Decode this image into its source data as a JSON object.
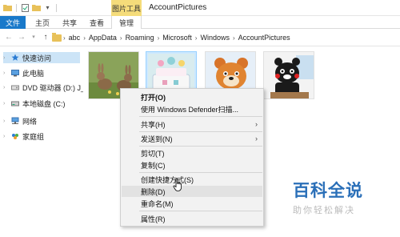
{
  "titlebar": {
    "context_tab_header": "图片工具",
    "window_title": "AccountPictures"
  },
  "ribbon": {
    "tabs": [
      {
        "label": "文件"
      },
      {
        "label": "主页"
      },
      {
        "label": "共享"
      },
      {
        "label": "查看"
      },
      {
        "label": "管理"
      }
    ]
  },
  "address": {
    "crumbs": [
      "abc",
      "AppData",
      "Roaming",
      "Microsoft",
      "Windows",
      "AccountPictures"
    ]
  },
  "navpane": {
    "items": [
      {
        "label": "快速访问",
        "icon": "star-icon"
      },
      {
        "label": "此电脑",
        "icon": "computer-icon"
      },
      {
        "label": "DVD 驱动器 (D:) J_C",
        "icon": "dvd-icon"
      },
      {
        "label": "本地磁盘 (C:)",
        "icon": "drive-icon"
      },
      {
        "label": "网络",
        "icon": "network-icon"
      },
      {
        "label": "家庭组",
        "icon": "homegroup-icon"
      }
    ]
  },
  "files": [
    {
      "name": "rabbits",
      "icon": "image-thumbnail"
    },
    {
      "name": "cake",
      "icon": "image-thumbnail"
    },
    {
      "name": "bear",
      "icon": "image-thumbnail"
    },
    {
      "name": "kumamon",
      "icon": "image-thumbnail"
    }
  ],
  "context_menu": {
    "items": [
      {
        "label": "打开(O)"
      },
      {
        "label": "使用 Windows Defender扫描..."
      },
      {
        "label": "共享(H)"
      },
      {
        "label": "发送到(N)"
      },
      {
        "label": "剪切(T)"
      },
      {
        "label": "复制(C)"
      },
      {
        "label": "创建快捷方式(S)"
      },
      {
        "label": "删除(D)"
      },
      {
        "label": "重命名(M)"
      },
      {
        "label": "属性(R)"
      }
    ]
  },
  "watermark": {
    "main": "百科全说",
    "sub": "助你轻松解决"
  },
  "colors": {
    "file_tab": "#1979ca",
    "context_tab": "#f5dc7a",
    "selection": "#cce8ff",
    "watermark": "#2a6fb8"
  }
}
